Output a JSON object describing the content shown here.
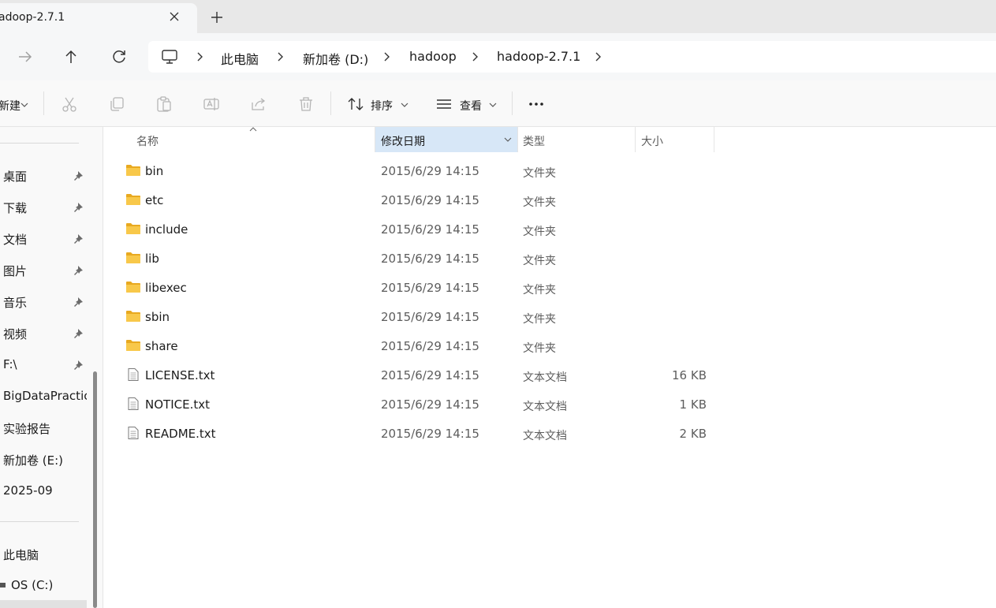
{
  "tab": {
    "title": "adoop-2.7.1"
  },
  "breadcrumb": [
    "此电脑",
    "新加卷 (D:)",
    "hadoop",
    "hadoop-2.7.1"
  ],
  "commands": {
    "new_label": "新建",
    "sort_label": "排序",
    "view_label": "查看"
  },
  "sidebar": {
    "quick_access": [
      {
        "label": "桌面",
        "pinned": true
      },
      {
        "label": "下载",
        "pinned": true
      },
      {
        "label": "文档",
        "pinned": true
      },
      {
        "label": "图片",
        "pinned": true
      },
      {
        "label": "音乐",
        "pinned": true
      },
      {
        "label": "视频",
        "pinned": true
      },
      {
        "label": "F:\\",
        "pinned": true
      },
      {
        "label": "BigDataPractice",
        "pinned": false
      },
      {
        "label": "实验报告",
        "pinned": false
      },
      {
        "label": "新加卷 (E:)",
        "pinned": false
      },
      {
        "label": "2025-09",
        "pinned": false
      }
    ],
    "this_pc": "此电脑",
    "drive_c": "OS (C:)"
  },
  "columns": {
    "name": "名称",
    "date": "修改日期",
    "type": "类型",
    "size": "大小"
  },
  "files": [
    {
      "name": "bin",
      "date": "2015/6/29 14:15",
      "type": "文件夹",
      "size": "",
      "icon": "folder-icon"
    },
    {
      "name": "etc",
      "date": "2015/6/29 14:15",
      "type": "文件夹",
      "size": "",
      "icon": "folder-icon"
    },
    {
      "name": "include",
      "date": "2015/6/29 14:15",
      "type": "文件夹",
      "size": "",
      "icon": "folder-icon"
    },
    {
      "name": "lib",
      "date": "2015/6/29 14:15",
      "type": "文件夹",
      "size": "",
      "icon": "folder-icon"
    },
    {
      "name": "libexec",
      "date": "2015/6/29 14:15",
      "type": "文件夹",
      "size": "",
      "icon": "folder-icon"
    },
    {
      "name": "sbin",
      "date": "2015/6/29 14:15",
      "type": "文件夹",
      "size": "",
      "icon": "folder-icon"
    },
    {
      "name": "share",
      "date": "2015/6/29 14:15",
      "type": "文件夹",
      "size": "",
      "icon": "folder-icon"
    },
    {
      "name": "LICENSE.txt",
      "date": "2015/6/29 14:15",
      "type": "文本文档",
      "size": "16 KB",
      "icon": "text-file-icon"
    },
    {
      "name": "NOTICE.txt",
      "date": "2015/6/29 14:15",
      "type": "文本文档",
      "size": "1 KB",
      "icon": "text-file-icon"
    },
    {
      "name": "README.txt",
      "date": "2015/6/29 14:15",
      "type": "文本文档",
      "size": "2 KB",
      "icon": "text-file-icon"
    }
  ],
  "colors": {
    "folder": "#f8c84a",
    "folder_dark": "#e8a920",
    "header_active": "#d7e7f7",
    "sidebar_bg": "#f9f9f9"
  }
}
